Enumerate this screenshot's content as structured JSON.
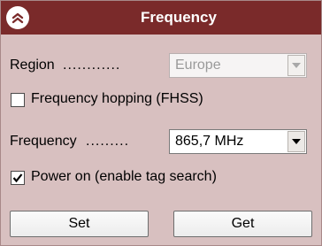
{
  "window": {
    "title": "Frequency"
  },
  "header": {
    "collapse_icon": "double-chevron-up-icon"
  },
  "region": {
    "label": "Region",
    "leader": "............",
    "selected": "Europe",
    "enabled": false
  },
  "hopping": {
    "label": "Frequency hopping (FHSS)",
    "checked": false
  },
  "frequency": {
    "label": "Frequency",
    "leader": ".........",
    "selected": "865,7 MHz"
  },
  "power": {
    "label": "Power on (enable tag search)",
    "checked": true
  },
  "buttons": {
    "set_label": "Set",
    "get_label": "Get"
  },
  "colors": {
    "header_bg": "#7a2a2a",
    "panel_bg": "#d8c0c0",
    "header_text": "#ffffff"
  }
}
